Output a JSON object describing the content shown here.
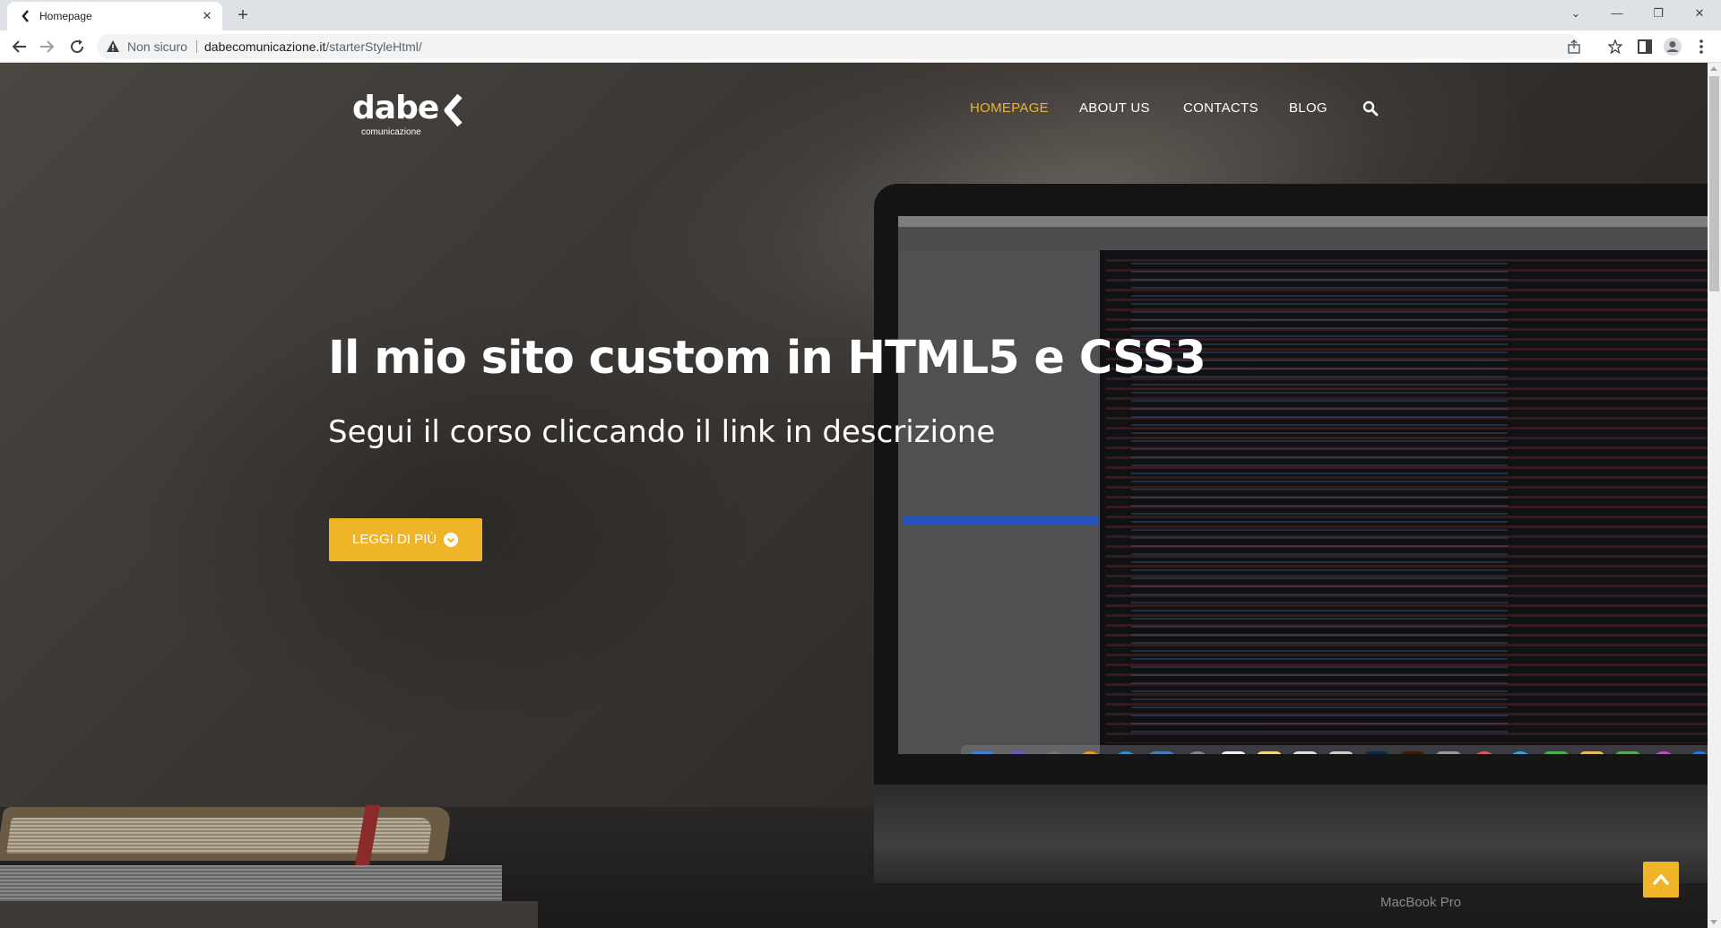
{
  "browser": {
    "tab_title": "Homepage",
    "security_label": "Non sicuro",
    "url_host": "dabecomunicazione.it",
    "url_path": "/starterStyleHtml/"
  },
  "site": {
    "logo_text": "dabe",
    "logo_subtext": "comunicazione",
    "nav": [
      {
        "label": "HOMEPAGE",
        "active": true
      },
      {
        "label": "ABOUT US",
        "active": false
      },
      {
        "label": "CONTACTS",
        "active": false
      },
      {
        "label": "BLOG",
        "active": false
      }
    ],
    "hero": {
      "title": "Il mio sito custom in HTML5 e CSS3",
      "subtitle": "Segui il corso cliccando il link in descrizione",
      "cta_label": "LEGGI DI PIÙ"
    },
    "laptop_label": "MacBook Pro"
  },
  "colors": {
    "accent": "#f0b429",
    "nav_text": "#ffffff"
  },
  "icons": {
    "search": "search-icon",
    "cta": "chevron-down-circle-icon",
    "back_to_top": "chevron-up-icon"
  }
}
